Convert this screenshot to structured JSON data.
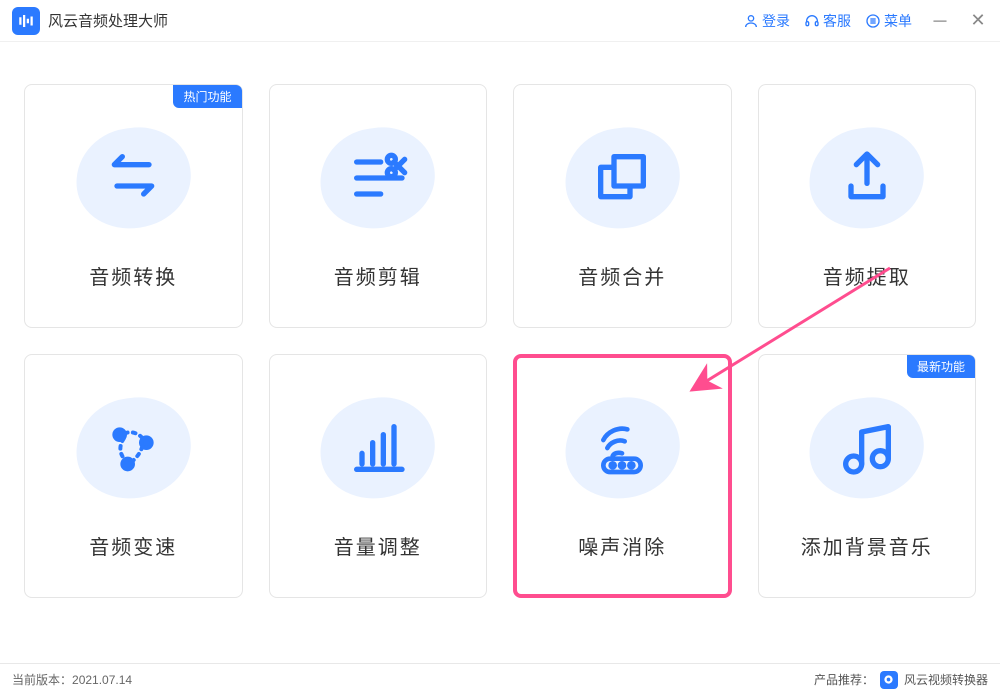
{
  "app": {
    "title": "风云音频处理大师"
  },
  "titlebar": {
    "login": "登录",
    "service": "客服",
    "menu": "菜单"
  },
  "badges": {
    "hot": "热门功能",
    "new": "最新功能"
  },
  "cards": [
    {
      "label": "音频转换"
    },
    {
      "label": "音频剪辑"
    },
    {
      "label": "音频合并"
    },
    {
      "label": "音频提取"
    },
    {
      "label": "音频变速"
    },
    {
      "label": "音量调整"
    },
    {
      "label": "噪声消除"
    },
    {
      "label": "添加背景音乐"
    }
  ],
  "footer": {
    "version_label": "当前版本：",
    "version": "2021.07.14",
    "reco_label": "产品推荐：",
    "reco_name": "风云视频转换器"
  },
  "colors": {
    "brand": "#2b7aff",
    "highlight": "#ff4d8f",
    "blob": "#eaf2ff"
  }
}
